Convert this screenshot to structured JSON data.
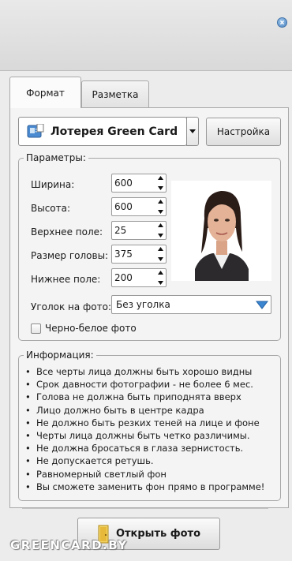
{
  "tabs": [
    {
      "label": "Формат",
      "active": true
    },
    {
      "label": "Разметка",
      "active": false
    }
  ],
  "format": {
    "selected": "Лотерея Green Card",
    "settings_label": "Настройка"
  },
  "params": {
    "title": "Параметры:",
    "fields": [
      {
        "label": "Ширина:",
        "value": "600"
      },
      {
        "label": "Высота:",
        "value": "600"
      },
      {
        "label": "Верхнее поле:",
        "value": "25"
      },
      {
        "label": "Размер головы:",
        "value": "375"
      },
      {
        "label": "Нижнее поле:",
        "value": "200"
      }
    ],
    "corner_label": "Уголок на фото:",
    "corner_value": "Без уголка",
    "bw_label": "Черно-белое фото",
    "bw_checked": false
  },
  "info": {
    "title": "Информация:",
    "items": [
      "Все черты лица должны быть хорошо видны",
      "Срок давности фотографии - не более 6 мес.",
      "Голова не должна быть приподнята вверх",
      "Лицо должно быть в центре кадра",
      "Не должно быть резких теней на лице и фоне",
      "Черты лица должны быть четко различимы.",
      "Не должна бросаться в глаза зернистость.",
      "Не допускается ретушь.",
      "Равномерный светлый фон",
      "Вы сможете заменить фон прямо в программе!"
    ]
  },
  "open_button": "Открыть фото",
  "watermark": "GREENCARD.BY",
  "colors": {
    "accent": "#4f86c2",
    "panel": "#f4f4f4"
  }
}
